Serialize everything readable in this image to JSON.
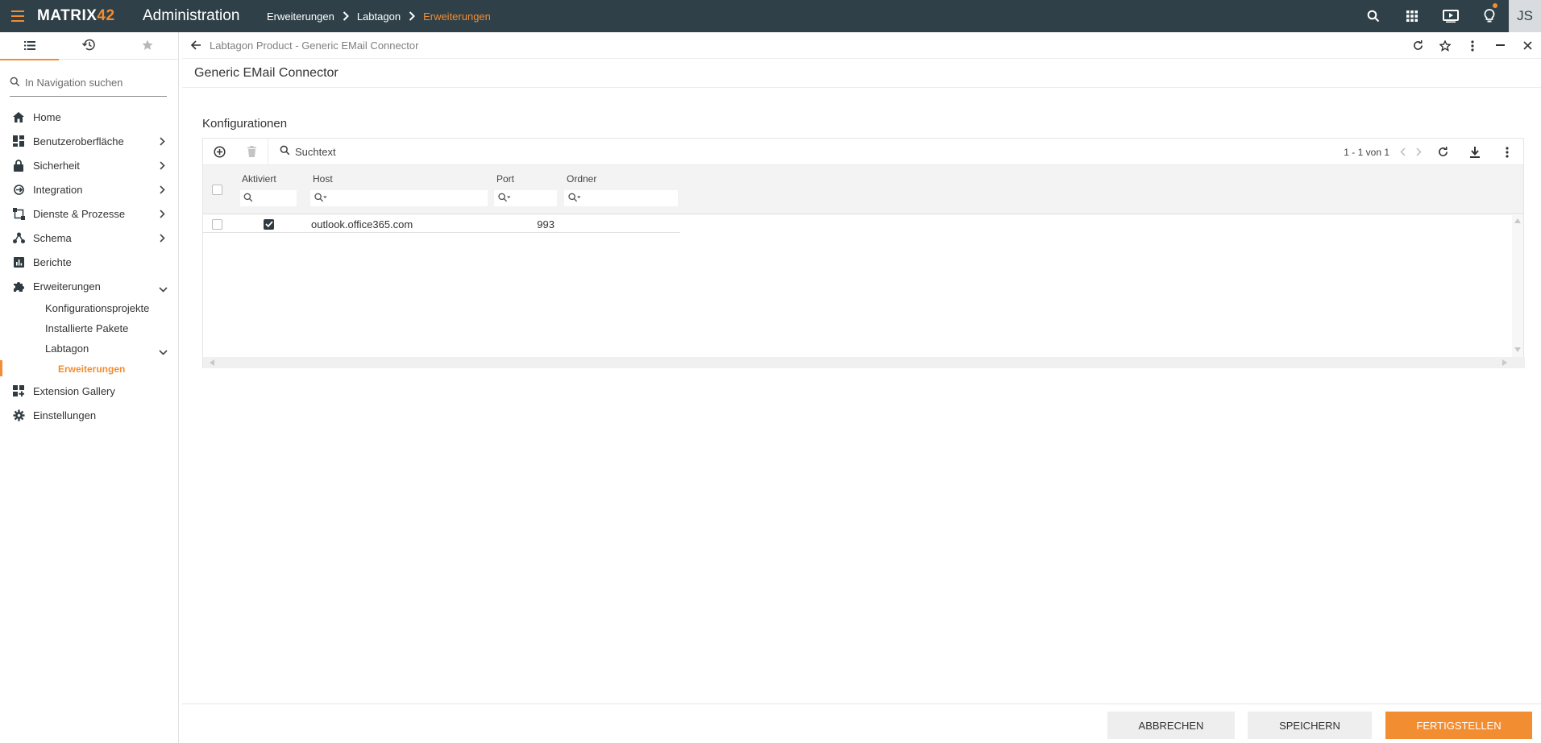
{
  "topbar": {
    "logo_main": "MATRIX",
    "logo_accent": "42",
    "app_title": "Administration",
    "breadcrumb": [
      {
        "label": "Erweiterungen"
      },
      {
        "label": "Labtagon"
      },
      {
        "label": "Erweiterungen"
      }
    ],
    "avatar_initials": "JS",
    "accent_color": "#f28d31",
    "bar_color": "#2f4048"
  },
  "sidebar": {
    "search_placeholder": "In Navigation suchen",
    "items": [
      {
        "label": "Home",
        "icon": "home-icon"
      },
      {
        "label": "Benutzeroberfläche",
        "icon": "dashboard-icon"
      },
      {
        "label": "Sicherheit",
        "icon": "lock-icon"
      },
      {
        "label": "Integration",
        "icon": "integration-icon"
      },
      {
        "label": "Dienste & Prozesse",
        "icon": "process-icon"
      },
      {
        "label": "Schema",
        "icon": "schema-icon"
      },
      {
        "label": "Berichte",
        "icon": "report-icon"
      },
      {
        "label": "Erweiterungen",
        "icon": "puzzle-icon"
      },
      {
        "label": "Extension Gallery",
        "icon": "gallery-icon"
      },
      {
        "label": "Einstellungen",
        "icon": "gear-icon"
      }
    ],
    "sub_items": [
      {
        "label": "Konfigurationsprojekte"
      },
      {
        "label": "Installierte Pakete"
      },
      {
        "label": "Labtagon"
      }
    ],
    "active_item": "Erweiterungen"
  },
  "main": {
    "subtitle": "Labtagon Product - Generic EMail Connector",
    "title": "Generic EMail Connector",
    "section_title": "Konfigurationen",
    "grid": {
      "search_placeholder": "Suchtext",
      "pager": "1 - 1 von 1",
      "columns": [
        "Aktiviert",
        "Host",
        "Port",
        "Ordner"
      ],
      "rows": [
        {
          "aktiviert": true,
          "host": "outlook.office365.com",
          "port": "993",
          "ordner": ""
        }
      ]
    },
    "footer": {
      "cancel_label": "ABBRECHEN",
      "save_label": "SPEICHERN",
      "finish_label": "FERTIGSTELLEN"
    }
  }
}
